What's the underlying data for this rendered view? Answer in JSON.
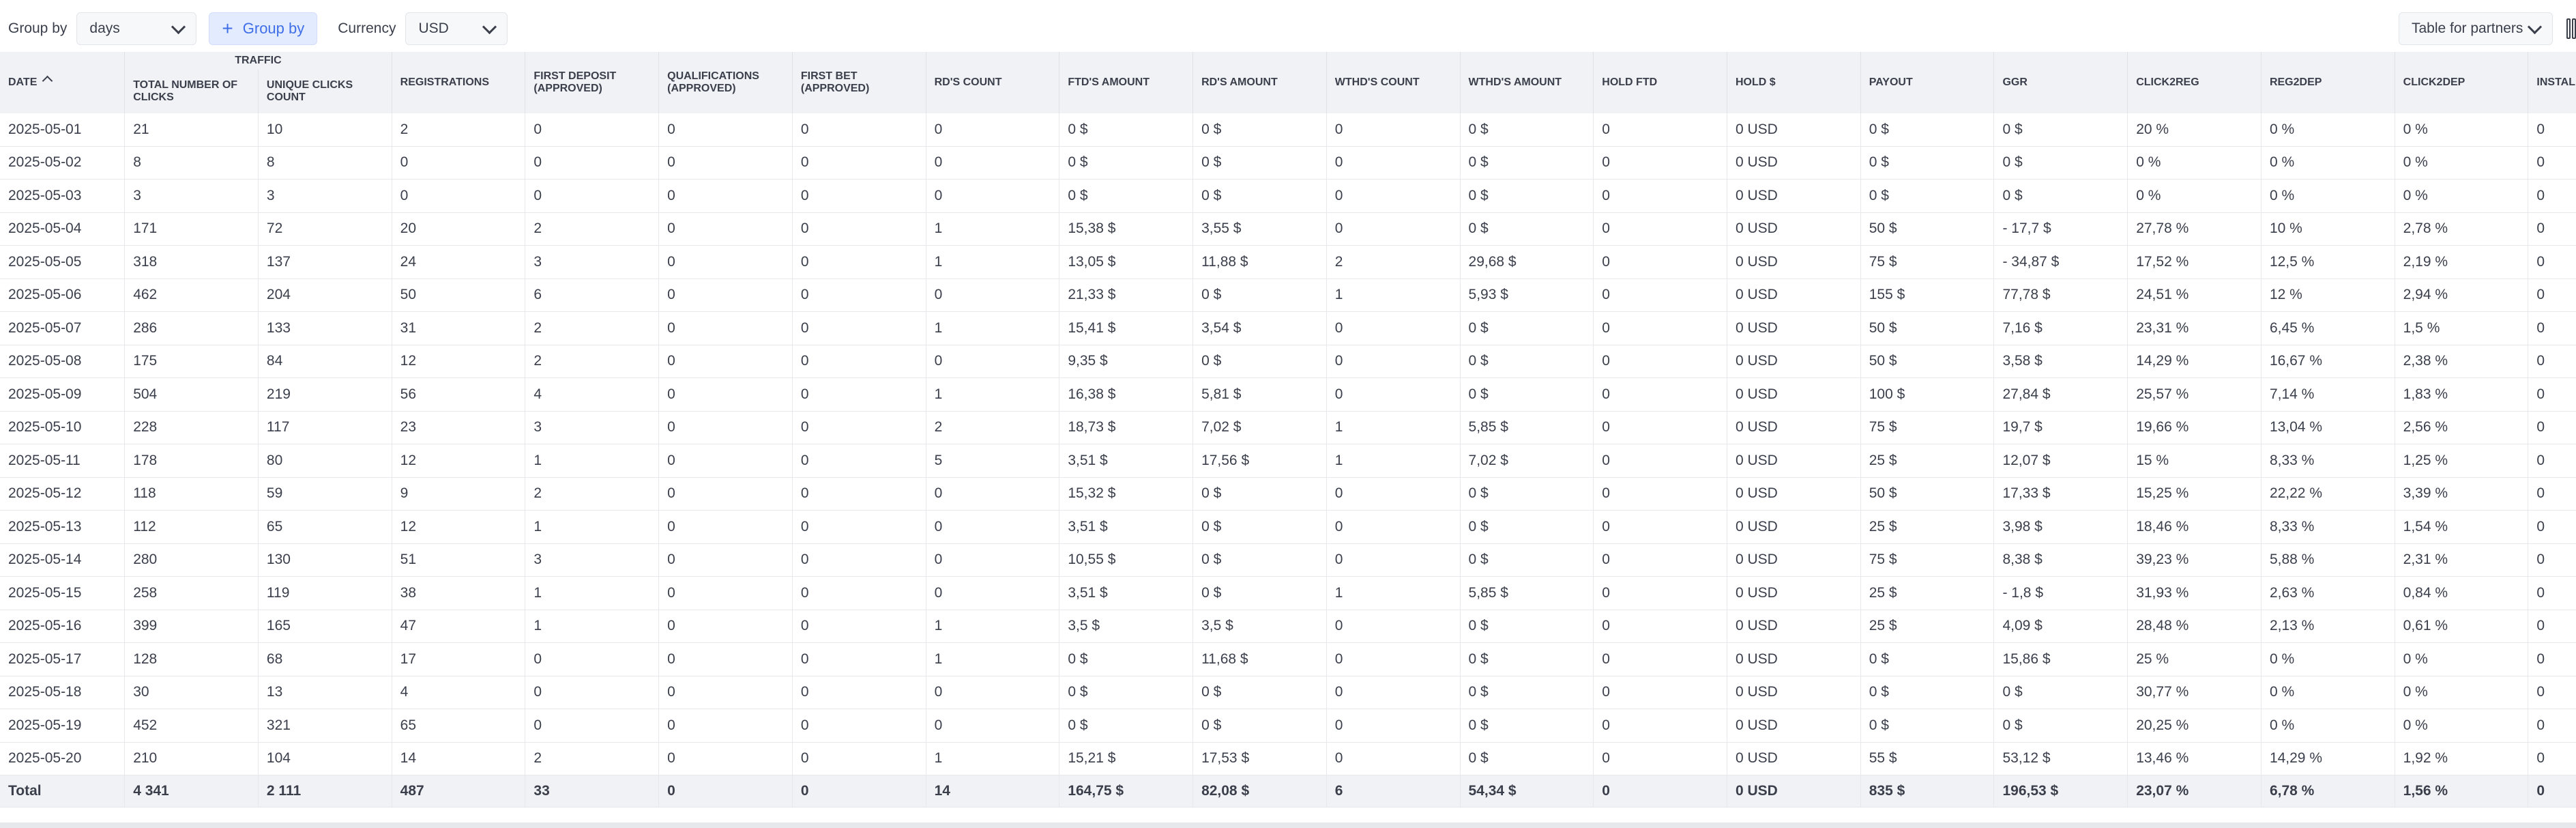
{
  "toolbar": {
    "group_by_label": "Group by",
    "group_by_value": "days",
    "group_by_button": "Group by",
    "currency_label": "Currency",
    "currency_value": "USD",
    "table_for_value": "Table for partners"
  },
  "table": {
    "group_header": "TRAFFIC",
    "columns": [
      "DATE",
      "TOTAL NUMBER OF CLICKS",
      "UNIQUE CLICKS COUNT",
      "REGISTRATIONS",
      "FIRST DEPOSIT (APPROVED)",
      "QUALIFICATIONS (APPROVED)",
      "FIRST BET (APPROVED)",
      "RD'S COUNT",
      "FTD'S AMOUNT",
      "RD'S AMOUNT",
      "WTHD'S COUNT",
      "WTHD'S AMOUNT",
      "HOLD FTD",
      "HOLD $",
      "PAYOUT",
      "GGR",
      "CLICK2REG",
      "REG2DEP",
      "CLICK2DEP",
      "INSTALL"
    ],
    "rows": [
      [
        "2025-05-01",
        "21",
        "10",
        "2",
        "0",
        "0",
        "0",
        "0",
        "0 $",
        "0 $",
        "0",
        "0 $",
        "0",
        "0 USD",
        "0 $",
        "0 $",
        "20 %",
        "0 %",
        "0 %",
        "0"
      ],
      [
        "2025-05-02",
        "8",
        "8",
        "0",
        "0",
        "0",
        "0",
        "0",
        "0 $",
        "0 $",
        "0",
        "0 $",
        "0",
        "0 USD",
        "0 $",
        "0 $",
        "0 %",
        "0 %",
        "0 %",
        "0"
      ],
      [
        "2025-05-03",
        "3",
        "3",
        "0",
        "0",
        "0",
        "0",
        "0",
        "0 $",
        "0 $",
        "0",
        "0 $",
        "0",
        "0 USD",
        "0 $",
        "0 $",
        "0 %",
        "0 %",
        "0 %",
        "0"
      ],
      [
        "2025-05-04",
        "171",
        "72",
        "20",
        "2",
        "0",
        "0",
        "1",
        "15,38 $",
        "3,55 $",
        "0",
        "0 $",
        "0",
        "0 USD",
        "50 $",
        "- 17,7 $",
        "27,78 %",
        "10 %",
        "2,78 %",
        "0"
      ],
      [
        "2025-05-05",
        "318",
        "137",
        "24",
        "3",
        "0",
        "0",
        "1",
        "13,05 $",
        "11,88 $",
        "2",
        "29,68 $",
        "0",
        "0 USD",
        "75 $",
        "- 34,87 $",
        "17,52 %",
        "12,5 %",
        "2,19 %",
        "0"
      ],
      [
        "2025-05-06",
        "462",
        "204",
        "50",
        "6",
        "0",
        "0",
        "0",
        "21,33 $",
        "0 $",
        "1",
        "5,93 $",
        "0",
        "0 USD",
        "155 $",
        "77,78 $",
        "24,51 %",
        "12 %",
        "2,94 %",
        "0"
      ],
      [
        "2025-05-07",
        "286",
        "133",
        "31",
        "2",
        "0",
        "0",
        "1",
        "15,41 $",
        "3,54 $",
        "0",
        "0 $",
        "0",
        "0 USD",
        "50 $",
        "7,16 $",
        "23,31 %",
        "6,45 %",
        "1,5 %",
        "0"
      ],
      [
        "2025-05-08",
        "175",
        "84",
        "12",
        "2",
        "0",
        "0",
        "0",
        "9,35 $",
        "0 $",
        "0",
        "0 $",
        "0",
        "0 USD",
        "50 $",
        "3,58 $",
        "14,29 %",
        "16,67 %",
        "2,38 %",
        "0"
      ],
      [
        "2025-05-09",
        "504",
        "219",
        "56",
        "4",
        "0",
        "0",
        "1",
        "16,38 $",
        "5,81 $",
        "0",
        "0 $",
        "0",
        "0 USD",
        "100 $",
        "27,84 $",
        "25,57 %",
        "7,14 %",
        "1,83 %",
        "0"
      ],
      [
        "2025-05-10",
        "228",
        "117",
        "23",
        "3",
        "0",
        "0",
        "2",
        "18,73 $",
        "7,02 $",
        "1",
        "5,85 $",
        "0",
        "0 USD",
        "75 $",
        "19,7 $",
        "19,66 %",
        "13,04 %",
        "2,56 %",
        "0"
      ],
      [
        "2025-05-11",
        "178",
        "80",
        "12",
        "1",
        "0",
        "0",
        "5",
        "3,51 $",
        "17,56 $",
        "1",
        "7,02 $",
        "0",
        "0 USD",
        "25 $",
        "12,07 $",
        "15 %",
        "8,33 %",
        "1,25 %",
        "0"
      ],
      [
        "2025-05-12",
        "118",
        "59",
        "9",
        "2",
        "0",
        "0",
        "0",
        "15,32 $",
        "0 $",
        "0",
        "0 $",
        "0",
        "0 USD",
        "50 $",
        "17,33 $",
        "15,25 %",
        "22,22 %",
        "3,39 %",
        "0"
      ],
      [
        "2025-05-13",
        "112",
        "65",
        "12",
        "1",
        "0",
        "0",
        "0",
        "3,51 $",
        "0 $",
        "0",
        "0 $",
        "0",
        "0 USD",
        "25 $",
        "3,98 $",
        "18,46 %",
        "8,33 %",
        "1,54 %",
        "0"
      ],
      [
        "2025-05-14",
        "280",
        "130",
        "51",
        "3",
        "0",
        "0",
        "0",
        "10,55 $",
        "0 $",
        "0",
        "0 $",
        "0",
        "0 USD",
        "75 $",
        "8,38 $",
        "39,23 %",
        "5,88 %",
        "2,31 %",
        "0"
      ],
      [
        "2025-05-15",
        "258",
        "119",
        "38",
        "1",
        "0",
        "0",
        "0",
        "3,51 $",
        "0 $",
        "1",
        "5,85 $",
        "0",
        "0 USD",
        "25 $",
        "- 1,8 $",
        "31,93 %",
        "2,63 %",
        "0,84 %",
        "0"
      ],
      [
        "2025-05-16",
        "399",
        "165",
        "47",
        "1",
        "0",
        "0",
        "1",
        "3,5 $",
        "3,5 $",
        "0",
        "0 $",
        "0",
        "0 USD",
        "25 $",
        "4,09 $",
        "28,48 %",
        "2,13 %",
        "0,61 %",
        "0"
      ],
      [
        "2025-05-17",
        "128",
        "68",
        "17",
        "0",
        "0",
        "0",
        "1",
        "0 $",
        "11,68 $",
        "0",
        "0 $",
        "0",
        "0 USD",
        "0 $",
        "15,86 $",
        "25 %",
        "0 %",
        "0 %",
        "0"
      ],
      [
        "2025-05-18",
        "30",
        "13",
        "4",
        "0",
        "0",
        "0",
        "0",
        "0 $",
        "0 $",
        "0",
        "0 $",
        "0",
        "0 USD",
        "0 $",
        "0 $",
        "30,77 %",
        "0 %",
        "0 %",
        "0"
      ],
      [
        "2025-05-19",
        "452",
        "321",
        "65",
        "0",
        "0",
        "0",
        "0",
        "0 $",
        "0 $",
        "0",
        "0 $",
        "0",
        "0 USD",
        "0 $",
        "0 $",
        "20,25 %",
        "0 %",
        "0 %",
        "0"
      ],
      [
        "2025-05-20",
        "210",
        "104",
        "14",
        "2",
        "0",
        "0",
        "1",
        "15,21 $",
        "17,53 $",
        "0",
        "0 $",
        "0",
        "0 USD",
        "55 $",
        "53,12 $",
        "13,46 %",
        "14,29 %",
        "1,92 %",
        "0"
      ]
    ],
    "total": [
      "Total",
      "4 341",
      "2 111",
      "487",
      "33",
      "0",
      "0",
      "14",
      "164,75 $",
      "82,08 $",
      "6",
      "54,34 $",
      "0",
      "0 USD",
      "835 $",
      "196,53 $",
      "23,07 %",
      "6,78 %",
      "1,56 %",
      "0"
    ]
  }
}
